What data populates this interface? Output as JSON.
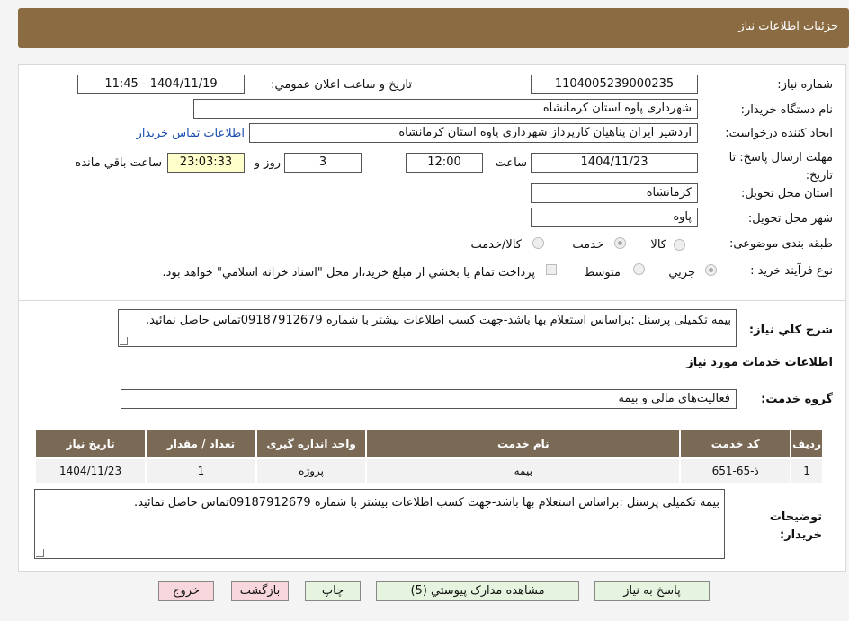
{
  "header": {
    "title": "جزئيات اطلاعات نياز"
  },
  "form": {
    "need_number_label": "شماره نياز:",
    "need_number": "1104005239000235",
    "announce_label": "تاريخ و ساعت اعلان عمومي:",
    "announce_value": "1404/11/19 - 11:45",
    "buyer_org_label": "نام دستگاه خريدار:",
    "buyer_org": "شهرداری پاوه استان کرمانشاه",
    "creator_label": "ايجاد کننده درخواست:",
    "creator": "اردشیر ایران پناهیان کارپرداز شهرداری پاوه استان کرمانشاه",
    "contact_link": "اطلاعات تماس خريدار",
    "deadline_label": "مهلت ارسال پاسخ: تا تاريخ:",
    "deadline_date": "1404/11/23",
    "time_label": "ساعت",
    "deadline_time": "12:00",
    "days": "3",
    "days_label": "روز و",
    "remaining": "23:03:33",
    "remaining_label": "ساعت باقي مانده",
    "province_label": "استان محل تحويل:",
    "province": "کرمانشاه",
    "city_label": "شهر محل تحويل:",
    "city": "پاوه",
    "category_label": "طبقه بندی موضوعی:",
    "category_options": [
      "کالا",
      "خدمت",
      "کالا/خدمت"
    ],
    "process_label": "نوع فرآيند خريد :",
    "process_options": [
      "جزيي",
      "متوسط"
    ],
    "payment_note": "پرداخت تمام يا بخشي از مبلغ خريد،از محل \"اسناد خزانه اسلامي\" خواهد بود."
  },
  "description": {
    "label": "شرح کلي نياز:",
    "text": "بیمه تکمیلی پرسنل :براساس استعلام بها باشد-جهت کسب اطلاعات بیشتر با شماره 09187912679تماس حاصل نمائید."
  },
  "services": {
    "section_title": "اطلاعات خدمات مورد نياز",
    "group_label": "گروه خدمت:",
    "group_value": "فعاليت‌هاي مالي و بيمه",
    "columns": [
      "رديف",
      "کد خدمت",
      "نام خدمت",
      "واحد اندازه گيری",
      "تعداد / مقدار",
      "تاريخ نياز"
    ],
    "rows": [
      [
        "1",
        "ذ-65-651",
        "بیمه",
        "پروژه",
        "1",
        "1404/11/23"
      ]
    ]
  },
  "buyer_notes": {
    "label": "توضيحات خريدار:",
    "text": "بیمه تکمیلی پرسنل :براساس استعلام بها باشد-جهت کسب اطلاعات بیشتر با شماره 09187912679تماس حاصل نمائید."
  },
  "buttons": {
    "reply": "پاسخ به نياز",
    "attachments": "مشاهده مدارک پيوستي (5)",
    "print": "چاپ",
    "back": "بازگشت",
    "exit": "خروج"
  }
}
